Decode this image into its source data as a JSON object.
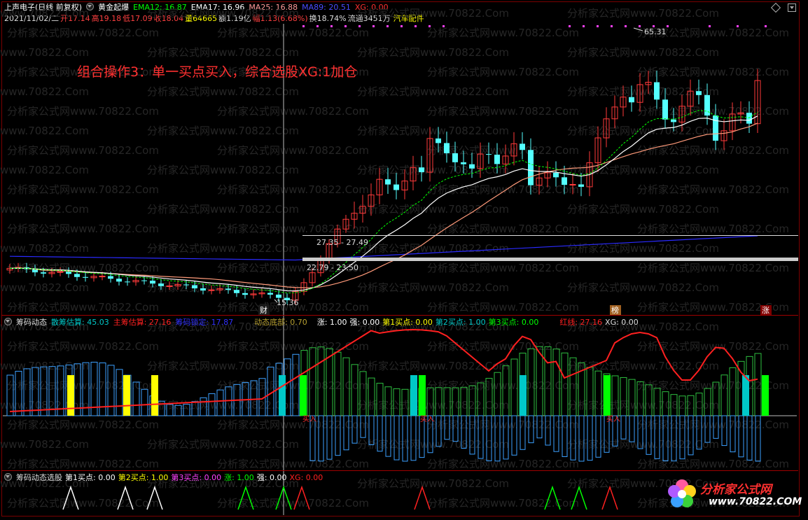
{
  "header": {
    "stock_name": "上声电子",
    "period": "(日线 前复权)",
    "indicator": "黄金起爆",
    "ema12": "EMA12: 16.87",
    "ema17": "EMA17: 16.96",
    "ma25": "MA25: 16.88",
    "ma89": "MA89: 20.51",
    "xg": "XG: 0.00"
  },
  "quote": {
    "date": "2021/11/02/二",
    "open": "开17.14",
    "high": "高19.18",
    "low": "低17.09",
    "close": "收18.04",
    "volume": "量64665",
    "amount": "额1.19亿",
    "change": "幅1.13(6.68%)",
    "turnover": "换18.74%",
    "float": "流通3451万",
    "sector": "汽车配件"
  },
  "annotation": "组合操作3：单一买点买入，综合选股XG:1加仓",
  "price_labels": {
    "high": "65.31",
    "low": "15.36",
    "band_upper": "27.35 - 27.49",
    "band_lower": "22.79 - 23.50"
  },
  "markers": {
    "cai": "财",
    "bang": "榜",
    "zhang": "涨"
  },
  "watermark": "分析家公式网www.70822.Com",
  "pane2": {
    "title": "筹码动态",
    "sanchou": "散筹估算: 45.03",
    "zhuchou": "主筹估算: 27.16",
    "suoding": "筹码锁定: 17.87",
    "dibu": "动态底部: 0.70",
    "zhang": "涨: 1.00",
    "qiang": "强: 0.00",
    "buy1": "第1买点: 0.00",
    "buy2": "第2买点: 1.00",
    "buy3": "第3买点: 0.00",
    "hongxian": "红线: 27.16",
    "xg": "XG: 0.00",
    "buy_label": "买入"
  },
  "pane3": {
    "title": "筹码动态选股",
    "buy1": "第1买点: 0.00",
    "buy2": "第2买点: 1.00",
    "buy3": "第3买点: 0.00",
    "zhang": "涨: 1.00",
    "qiang": "强: 0.00",
    "xg": "XG: 0.00"
  },
  "logo": {
    "name": "分析家公式网",
    "url": "www.70822.COM"
  },
  "colors": {
    "up": "#ff3a3a",
    "down": "#54ffff",
    "ema12": "#00ff00",
    "ema17": "#ffffff",
    "ma25": "#ff9a7a",
    "ma89": "#3a3aff",
    "red": "#ff2020",
    "cyan": "#00c8c8",
    "green": "#00ff00",
    "yellow": "#ffff00",
    "magenta": "#ff40ff"
  }
}
